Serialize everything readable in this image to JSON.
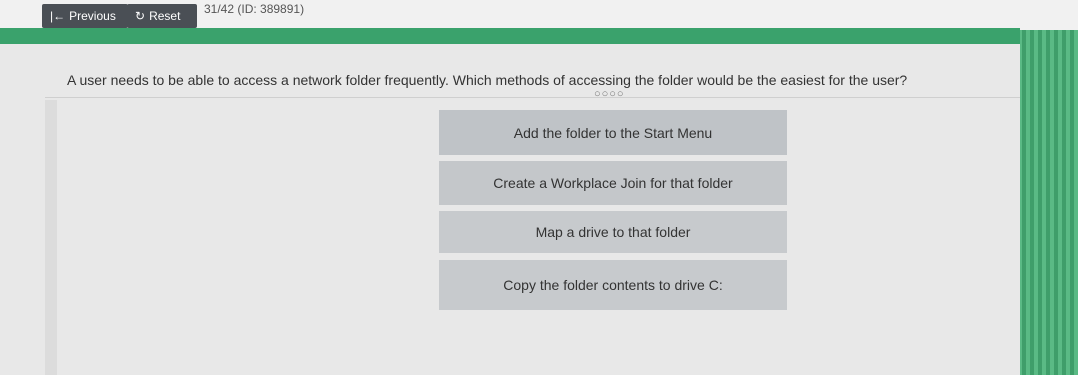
{
  "toolbar": {
    "previous_label": "Previous",
    "reset_label": "Reset",
    "counter": "31/42 (ID: 389891)"
  },
  "question": {
    "text": "A user needs to be able to access a network folder frequently. Which methods of accessing the folder would be the easiest for the user?",
    "dots": "○○○○"
  },
  "answers": [
    {
      "label": "Add the folder to the Start Menu"
    },
    {
      "label": "Create a Workplace Join for that folder"
    },
    {
      "label": "Map a drive to that folder"
    },
    {
      "label": "Copy the folder contents to drive C:"
    }
  ],
  "icons": {
    "previous": "first-page-arrow-icon",
    "reset": "reset-icon"
  },
  "colors": {
    "accent": "#3aa26c",
    "button": "#4a4f55",
    "answer": "#c4c7ca"
  }
}
